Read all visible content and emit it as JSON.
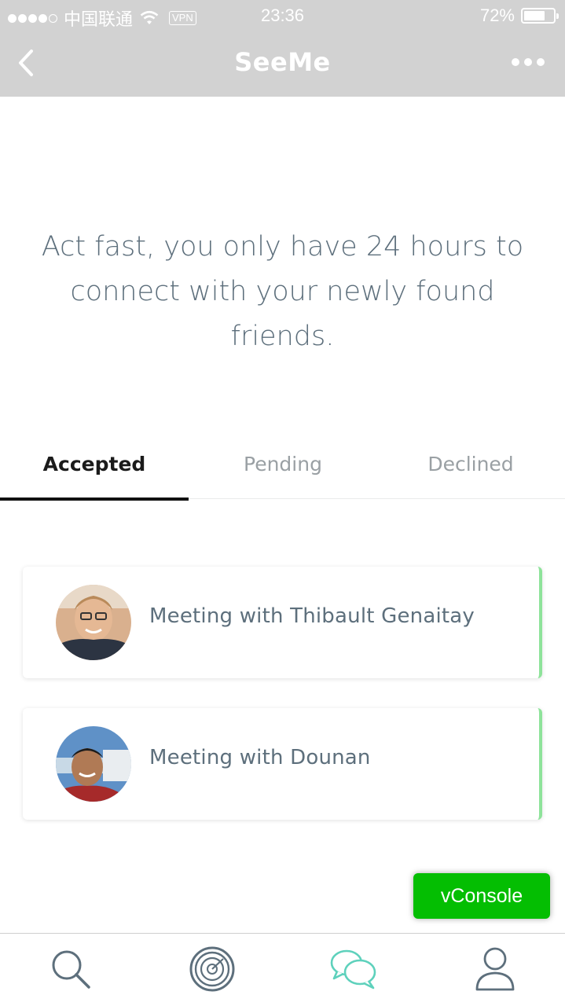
{
  "status_bar": {
    "carrier": "中国联通",
    "vpn": "VPN",
    "time": "23:36",
    "battery": "72%",
    "battery_level": 0.72
  },
  "nav": {
    "title": "SeeMe"
  },
  "hero": {
    "highlight": "Act fast",
    "rest": ", you only have 24 hours to connect with your newly found friends."
  },
  "tabs": [
    {
      "label": "Accepted",
      "active": true
    },
    {
      "label": "Pending",
      "active": false
    },
    {
      "label": "Declined",
      "active": false
    }
  ],
  "meetings": [
    {
      "label": "Meeting with Thibault Genaitay"
    },
    {
      "label": "Meeting with Dounan"
    }
  ],
  "vconsole": {
    "label": "vConsole"
  },
  "bottom_tabs": [
    {
      "icon": "search-icon"
    },
    {
      "icon": "radar-icon"
    },
    {
      "icon": "chat-icon",
      "active": true
    },
    {
      "icon": "profile-icon"
    }
  ],
  "colors": {
    "accent": "#5ed1bc",
    "text": "#5d6f7c",
    "nav_bg": "#d2d2d2",
    "vconsole": "#04be02",
    "card_edge": "#8ee39a"
  }
}
